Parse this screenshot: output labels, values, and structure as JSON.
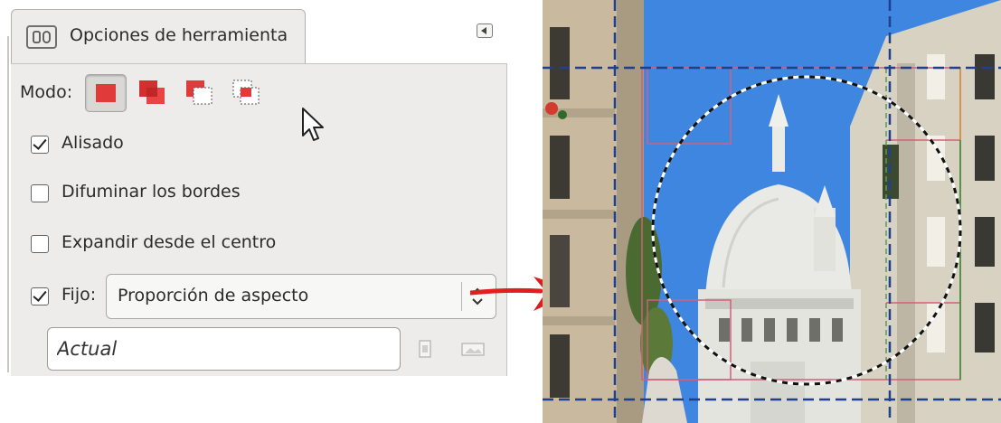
{
  "panel": {
    "tab_title": "Opciones de herramienta",
    "tab_icon": "tool-options-icon",
    "menu_icon": "triangle-left-icon"
  },
  "mode": {
    "label": "Modo:",
    "options": [
      "replace-mode-icon",
      "add-mode-icon",
      "subtract-mode-icon",
      "intersect-mode-icon"
    ],
    "selected": "replace",
    "accent_color": "#e03a3a"
  },
  "options": {
    "antialiasing": {
      "label": "Alisado",
      "checked": true
    },
    "feather": {
      "label": "Difuminar los bordes",
      "checked": false
    },
    "expand": {
      "label": "Expandir desde el centro",
      "checked": false
    },
    "fixed": {
      "label": "Fijo:",
      "checked": true,
      "value": "Proporción de aspecto"
    }
  },
  "aspect": {
    "placeholder": "Actual",
    "buttons": [
      "portrait-icon",
      "landscape-icon"
    ]
  },
  "colors": {
    "panel_bg": "#edecea",
    "pointer_arrow": "#e02020",
    "guide_line": "#1f3f8f",
    "sky": "#3f86e0"
  }
}
